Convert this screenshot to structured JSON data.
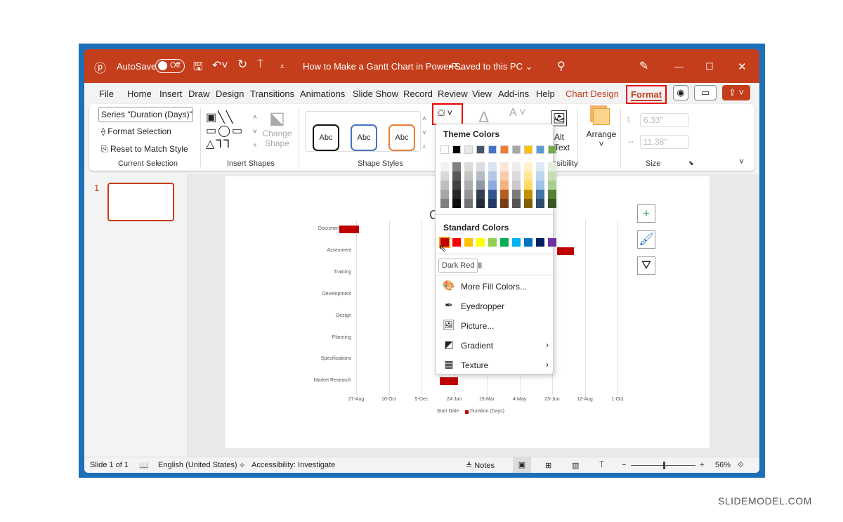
{
  "titlebar": {
    "autosave": "AutoSave",
    "toggle": "Off",
    "doc_title": "How to Make a Gantt Chart in PowerP...",
    "saved": "• Saved to this PC ⌄"
  },
  "tabs": [
    "File",
    "Home",
    "Insert",
    "Draw",
    "Design",
    "Transitions",
    "Animations",
    "Slide Show",
    "Record",
    "Review",
    "View",
    "Add-ins",
    "Help",
    "Chart Design",
    "Format"
  ],
  "ribbon": {
    "selection_dropdown": "Series \"Duration (Days)\"",
    "format_selection": "Format Selection",
    "reset_style": "Reset to Match Style",
    "group_current": "Current Selection",
    "change_shape": "Change Shape",
    "group_insert": "Insert Shapes",
    "style_sample": "Abc",
    "group_styles": "Shape Styles",
    "alt_text": "Alt Text",
    "group_access": "ssibility",
    "arrange": "Arrange",
    "height": "6.33\"",
    "width": "11.38\"",
    "group_size": "Size"
  },
  "fill_menu": {
    "theme_title": "Theme Colors",
    "theme_colors": [
      "#ffffff",
      "#000000",
      "#e7e6e6",
      "#44546a",
      "#4472c4",
      "#ed7d31",
      "#a5a5a5",
      "#ffc000",
      "#5b9bd5",
      "#70ad47"
    ],
    "standard_title": "Standard Colors",
    "standard_colors": [
      "#c00000",
      "#ff0000",
      "#ffc000",
      "#ffff00",
      "#92d050",
      "#00b050",
      "#00b0f0",
      "#0070c0",
      "#002060",
      "#7030a0"
    ],
    "tooltip": "Dark Red",
    "no_fill_partial": "ill",
    "items": [
      {
        "label": "More Fill Colors...",
        "icon": "palette-icon"
      },
      {
        "label": "Eyedropper",
        "icon": "eyedropper-icon"
      },
      {
        "label": "Picture...",
        "icon": "picture-icon"
      },
      {
        "label": "Gradient",
        "icon": "gradient-icon",
        "submenu": true
      },
      {
        "label": "Texture",
        "icon": "texture-icon",
        "submenu": true
      }
    ]
  },
  "slides": {
    "number": "1"
  },
  "chart_data": {
    "type": "bar",
    "orientation": "horizontal-stacked-gantt",
    "categories": [
      "Documentation",
      "Assesment",
      "Training",
      "Development",
      "Design",
      "Planning",
      "Specifications",
      "Market Research"
    ],
    "x_ticks": [
      "27-Aug",
      "16-Oct",
      "5-Dec",
      "24-Jan",
      "15-Mar",
      "4-May",
      "23-Jun",
      "12-Aug",
      "1-Oct"
    ],
    "series": [
      {
        "name": "Start Date",
        "color": "none",
        "values": [
          "1-Aug",
          "30-Jun",
          "15-Jun",
          null,
          null,
          null,
          null,
          "2-Jan"
        ]
      },
      {
        "name": "Duration (Days)",
        "color": "#c00000",
        "values": [
          30,
          26,
          10,
          null,
          null,
          null,
          null,
          28
        ]
      }
    ],
    "legend": "bottom",
    "grid": true
  },
  "status": {
    "slide": "Slide 1 of 1",
    "language": "English (United States)",
    "accessibility": "Accessibility: Investigate",
    "notes": "Notes",
    "zoom": "56%",
    "zoom_level": 56
  }
}
